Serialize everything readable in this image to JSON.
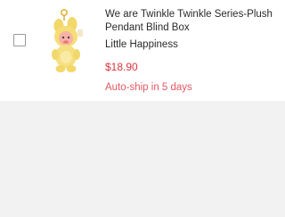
{
  "cart_item": {
    "title": "We are Twinkle Twinkle Series-Plush Pendant Blind Box",
    "variant": "Little Happiness",
    "price": "$18.90",
    "autoship": "Auto-ship in 5 days",
    "image_icon": "plush-pendant-image"
  },
  "colors": {
    "price": "#d9363e",
    "autoship": "#e25862",
    "background": "#f2f2f2"
  }
}
